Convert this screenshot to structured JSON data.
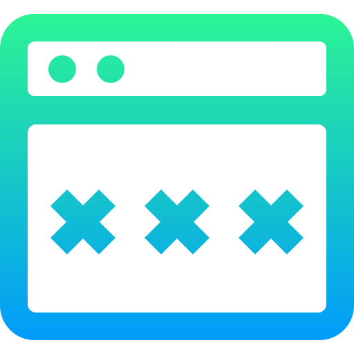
{
  "icon": {
    "name": "browser-window-password-icon",
    "gradient": {
      "top": "#2cf494",
      "bottom": "#019bfa"
    },
    "background": "#ffffff",
    "window_dots": 2,
    "password_marks": 3
  }
}
